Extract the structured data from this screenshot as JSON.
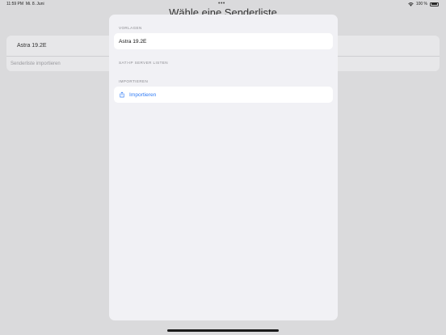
{
  "status_bar": {
    "time": "11:59 PM",
    "date": "Mi. 8. Juni",
    "dots": "•••",
    "battery_percent": "100 %"
  },
  "background": {
    "title": "Wähle eine Senderliste",
    "rows": [
      "Astra 19.2E",
      "Senderliste importieren"
    ]
  },
  "sheet": {
    "sections": [
      {
        "header": "VORLAGEN",
        "items": [
          "Astra 19.2E"
        ]
      },
      {
        "header": "SAT>IP SERVER LISTEN",
        "items": []
      },
      {
        "header": "IMPORTIEREN",
        "items": [
          "Importieren"
        ]
      }
    ]
  },
  "colors": {
    "accent": "#2f7bf5",
    "sheet_background": "#f1f1f5",
    "cell_background": "#ffffff",
    "header_text": "#8a8a8f"
  },
  "icons": {
    "import": "share-import-icon",
    "wifi": "wifi-icon",
    "battery": "battery-icon"
  }
}
